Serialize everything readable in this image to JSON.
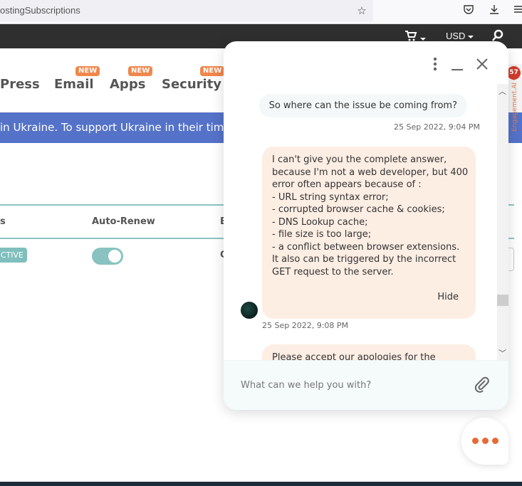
{
  "browser": {
    "url_fragment": "ostingSubscriptions",
    "icons": [
      "bookmark-star-icon",
      "pocket-icon",
      "download-icon",
      "menu-icon"
    ]
  },
  "topbar": {
    "cart_icon": "cart-icon",
    "currency": "USD",
    "search_icon": "search-icon"
  },
  "nav": {
    "items": [
      {
        "label": "Press",
        "badge": ""
      },
      {
        "label": "Email",
        "badge": "NEW"
      },
      {
        "label": "Apps",
        "badge": "NEW"
      },
      {
        "label": "Security",
        "badge": "NEW"
      }
    ]
  },
  "banner": {
    "text": "in Ukraine. To support Ukraine in their time"
  },
  "table": {
    "headers": [
      "s",
      "Auto-Renew",
      "E"
    ],
    "row": {
      "status": "CTIVE",
      "auto_renew": true,
      "partial": "C"
    }
  },
  "side_tab": {
    "label": "Engagement.AI Chat",
    "badge_count": "57"
  },
  "chat": {
    "header_icons": [
      "more-vert-icon",
      "minimize-icon",
      "close-icon"
    ],
    "messages": [
      {
        "from": "user",
        "text": "So where can the issue be coming from?",
        "time": "25 Sep 2022, 9:04 PM"
      },
      {
        "from": "agent",
        "lines": [
          "I can't give you the complete answer,",
          "because I'm not a web developer, but 400",
          "error often appears because of :",
          "- URL string syntax error;",
          "- corrupted browser cache & cookies;",
          "- DNS Lookup cache;",
          "- file size is too large;",
          "- a conflict between browser extensions.",
          "It also can be triggered by the incorrect",
          "GET request to the server."
        ],
        "hide_label": "Hide",
        "time": "25 Sep 2022, 9:08 PM"
      },
      {
        "from": "agent",
        "lines": [
          "Please accept our apologies for the"
        ]
      }
    ],
    "composer_placeholder": "What can we help you with?",
    "attach_icon": "paperclip-icon"
  },
  "launcher": {
    "icon": "typing-dots-icon"
  },
  "colors": {
    "accent_orange": "#e66a35",
    "teal": "#88c3c1",
    "banner_blue": "#5472c8",
    "agent_bubble": "#fdeee4"
  }
}
